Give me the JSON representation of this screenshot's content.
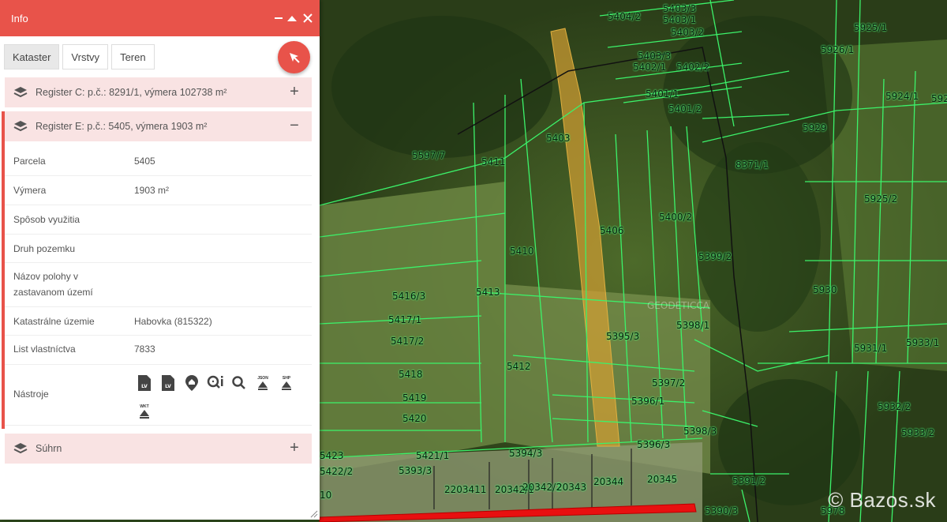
{
  "panel": {
    "title": "Info",
    "tabs": [
      "Kataster",
      "Vrstvy",
      "Teren"
    ],
    "sections": {
      "register_c": "Register C: p.č.: 8291/1, výmera 102738 m²",
      "register_e": "Register E: p.č.: 5405, výmera 1903 m²",
      "suhrn": "Súhrn"
    },
    "rows": [
      {
        "key": "Parcela",
        "value": "5405"
      },
      {
        "key": "Výmera",
        "value": "1903 m²"
      },
      {
        "key": "Spôsob využitia",
        "value": ""
      },
      {
        "key": "Druh pozemku",
        "value": ""
      },
      {
        "key": "Názov polohy v zastavanom území",
        "value": ""
      },
      {
        "key": "Katastrálne územie",
        "value": "Habovka (815322)"
      },
      {
        "key": "List vlastníctva",
        "value": "7833"
      },
      {
        "key": "Nástroje",
        "value": ""
      }
    ],
    "tools": {
      "lv1": "LV",
      "lv2": "LV",
      "json": "JSON",
      "shp": "SHP",
      "wkt": "WKT"
    }
  },
  "map": {
    "watermark": "Bazos.sk",
    "geodetica": "GEODETICCA",
    "labels": [
      "5404/2",
      "5403/3",
      "5403/1",
      "5403/2",
      "5925/1",
      "5926/1",
      "5403/3",
      "5402/1",
      "5402/2",
      "5924/1",
      "5401/1",
      "5401/2",
      "5929",
      "5597/7",
      "5411",
      "5403",
      "8371/1",
      "5925/2",
      "5400/2",
      "5406",
      "5410",
      "5399/2",
      "5416/3",
      "5413",
      "5930",
      "5417/1",
      "5398/1",
      "5417/2",
      "5395/3",
      "5931/1",
      "5933/1",
      "5412",
      "5418",
      "5397/2",
      "5419",
      "5396/1",
      "5932/2",
      "5420",
      "5398/3",
      "5933/2",
      "5396/3",
      "5423",
      "5421/1",
      "5394/3",
      "5422/2",
      "5393/3",
      "2203411",
      "20342/1",
      "20342/2",
      "20343",
      "20344",
      "20345",
      "5391/2",
      "5390/3",
      "5978",
      "10",
      "592"
    ],
    "colors": {
      "parcel_line": "#3cf26a",
      "highlight": "#d4a033",
      "road": "#e81010",
      "accent": "#e8534a"
    }
  }
}
